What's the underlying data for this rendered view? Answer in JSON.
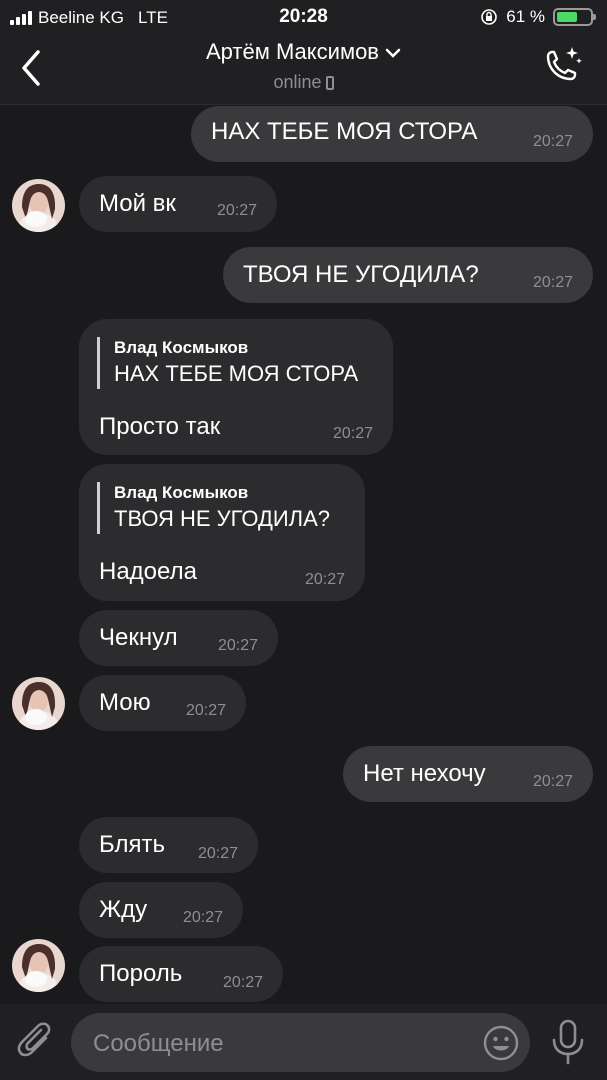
{
  "status_bar": {
    "carrier": "Beeline KG",
    "network": "LTE",
    "time": "20:28",
    "battery": "61 %",
    "battery_level": 0.61
  },
  "header": {
    "contact_name": "Артём Максимов",
    "contact_status": "online"
  },
  "messages": [
    {
      "direction": "out",
      "text": "НАХ ТЕБЕ МОЯ СТОРА",
      "time": "20:27"
    },
    {
      "direction": "in",
      "text": "Мой вк",
      "time": "20:27",
      "avatar": true
    },
    {
      "direction": "out",
      "text": "ТВОЯ НЕ УГОДИЛА?",
      "time": "20:27"
    },
    {
      "direction": "in",
      "text": "Просто так",
      "time": "20:27",
      "reply_author": "Влад Космыков",
      "reply_text": "НАХ ТЕБЕ МОЯ СТОРА"
    },
    {
      "direction": "in",
      "text": "Надоела",
      "time": "20:27",
      "reply_author": "Влад Космыков",
      "reply_text": "ТВОЯ НЕ УГОДИЛА?"
    },
    {
      "direction": "in",
      "text": "Чекнул",
      "time": "20:27"
    },
    {
      "direction": "in",
      "text": "Мою",
      "time": "20:27",
      "avatar": true
    },
    {
      "direction": "out",
      "text": "Нет нехочу",
      "time": "20:27"
    },
    {
      "direction": "in",
      "text": "Блять",
      "time": "20:27"
    },
    {
      "direction": "in",
      "text": "Жду",
      "time": "20:27"
    },
    {
      "direction": "in",
      "text": "Пороль",
      "time": "20:27",
      "avatar": true
    }
  ],
  "composer": {
    "placeholder": "Сообщение"
  },
  "icons": {
    "back": "chevron-left-icon",
    "call": "phone-call-icon",
    "attach": "paperclip-icon",
    "emoji": "smiley-icon",
    "mic": "microphone-icon"
  },
  "colors": {
    "background": "#1a1a1c",
    "incoming_bubble": "#2c2c2e",
    "outgoing_bubble": "#3a3a3c",
    "secondary_text": "#8e8e93",
    "battery_fill": "#4cd964"
  }
}
